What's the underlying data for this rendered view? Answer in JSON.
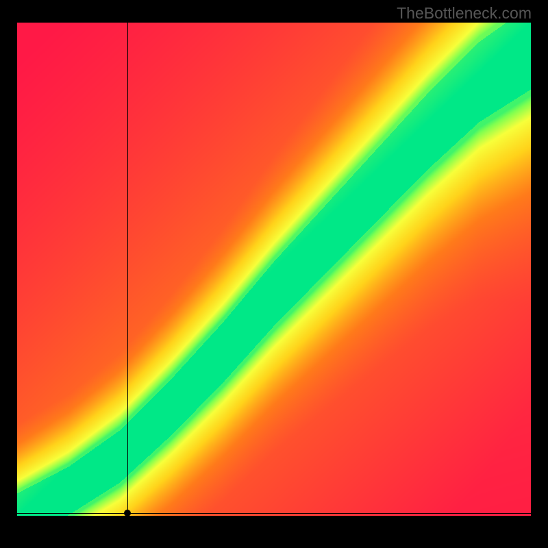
{
  "watermark": "TheBottleneck.com",
  "chart_data": {
    "type": "heatmap",
    "title": "",
    "xlabel": "",
    "ylabel": "",
    "xlim": [
      0,
      1
    ],
    "ylim": [
      0,
      1
    ],
    "grid_size": 160,
    "ridge": {
      "description": "Optimal compatibility ridge (green band) curving from bottom-left origin to top-right corner; value falls off toward red away from ridge.",
      "control_points_xy": [
        [
          0.0,
          0.0
        ],
        [
          0.1,
          0.05
        ],
        [
          0.2,
          0.12
        ],
        [
          0.3,
          0.22
        ],
        [
          0.4,
          0.33
        ],
        [
          0.5,
          0.45
        ],
        [
          0.6,
          0.56
        ],
        [
          0.7,
          0.67
        ],
        [
          0.8,
          0.78
        ],
        [
          0.9,
          0.88
        ],
        [
          1.0,
          0.95
        ]
      ],
      "green_band_halfwidth": 0.045,
      "yellow_band_halfwidth": 0.1
    },
    "color_scale": {
      "0.0": "#ff1946",
      "0.4": "#ff7a1a",
      "0.6": "#ffd21a",
      "0.78": "#f7ff3a",
      "0.9": "#7fff50",
      "1.0": "#00e887"
    },
    "crosshair": {
      "x": 0.215,
      "y": 0.005
    },
    "marker": {
      "x": 0.215,
      "y": 0.005
    }
  }
}
